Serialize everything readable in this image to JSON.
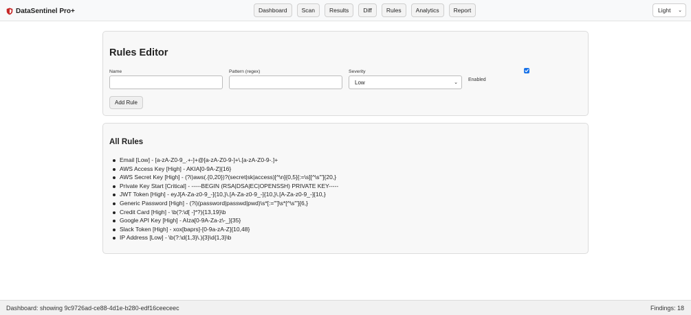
{
  "app": {
    "title": "DataSentinel Pro+",
    "brand_color": "#c62828"
  },
  "nav": {
    "items": [
      "Dashboard",
      "Scan",
      "Results",
      "Diff",
      "Rules",
      "Analytics",
      "Report"
    ]
  },
  "theme": {
    "selected": "Light"
  },
  "editor": {
    "title": "Rules Editor",
    "name_label": "Name",
    "name_value": "",
    "pattern_label": "Pattern (regex)",
    "pattern_value": "",
    "severity_label": "Severity",
    "severity_selected": "Low",
    "enabled_label": "Enabled",
    "enabled_checked": true,
    "add_button": "Add Rule"
  },
  "rules": {
    "title": "All Rules",
    "items": [
      "Email [Low] - [a-zA-Z0-9_.+-]+@[a-zA-Z0-9-]+\\.[a-zA-Z0-9-.]+",
      "AWS Access Key [High] - AKIA[0-9A-Z]{16}",
      "AWS Secret Key [High] - (?i)aws(.{0,20})?(secret|sk|access)[^\\n]{0,5}[:=\\s][^\\s'\"]{20,}",
      "Private Key Start [Critical] - -----BEGIN (RSA|DSA|EC|OPENSSH) PRIVATE KEY-----",
      "JWT Token [High] - eyJ[A-Za-z0-9_-]{10,}\\.[A-Za-z0-9_-]{10,}\\.[A-Za-z0-9_-]{10,}",
      "Generic Password [High] - (?i)(password|passwd|pwd)\\s*[:=\"']\\s*[^\\s'\"]{6,}",
      "Credit Card [High] - \\b(?:\\d[ -]*?){13,19}\\b",
      "Google API Key [High] - AIza[0-9A-Za-z\\-_]{35}",
      "Slack Token [High] - xox[baprs]-[0-9a-zA-Z]{10,48}",
      "IP Address [Low] - \\b(?:\\d{1,3}\\.){3}\\d{1,3}\\b"
    ]
  },
  "status": {
    "left": "Dashboard: showing 9c9726ad-ce88-4d1e-b280-edf16ceeceec",
    "right": "Findings: 18"
  },
  "icons": {
    "brand": "shield-icon",
    "dropdown": "chevron-down-icon",
    "checkbox": "checkmark-icon"
  }
}
